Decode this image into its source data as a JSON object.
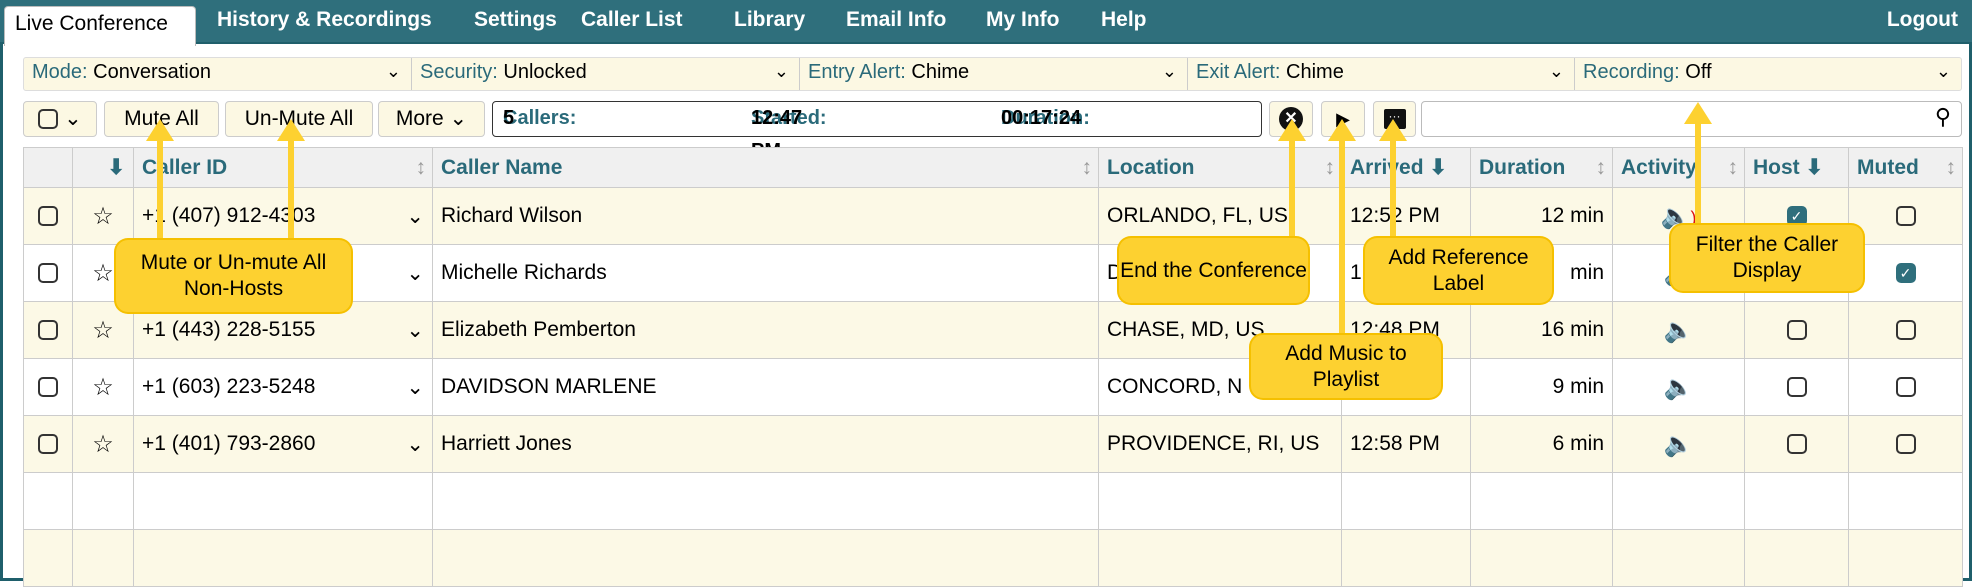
{
  "tabs": [
    "Live Conference",
    "History & Recordings",
    "Settings",
    "Caller List",
    "Library",
    "Email Info",
    "My Info",
    "Help"
  ],
  "logout": "Logout",
  "selectors": [
    {
      "key": "Mode:",
      "value": "Conversation"
    },
    {
      "key": "Security:",
      "value": "Unlocked"
    },
    {
      "key": "Entry Alert:",
      "value": "Chime"
    },
    {
      "key": "Exit Alert:",
      "value": "Chime"
    },
    {
      "key": "Recording:",
      "value": "Off"
    }
  ],
  "toolbar": {
    "mute_all": "Mute All",
    "unmute_all": "Un-Mute All",
    "more": "More",
    "callers_label": "Callers:",
    "callers": "5",
    "started_label": "Started:",
    "started": "12:47 PM",
    "duration_label": "Duration:",
    "duration": "00:17:24",
    "search_placeholder": ""
  },
  "columns": [
    "Caller ID",
    "Caller Name",
    "Location",
    "Arrived",
    "Duration",
    "Activity",
    "Host",
    "Muted"
  ],
  "rows": [
    {
      "caller_id": "+1 (407) 912-4303",
      "name": "Richard Wilson",
      "location": "ORLANDO, FL, US",
      "arrived": "12:52 PM",
      "duration": "12 min",
      "activity": "speaking",
      "host": true,
      "muted": false
    },
    {
      "caller_id": "",
      "name": "Michelle Richards",
      "location": "D",
      "arrived": "1",
      "duration": "min",
      "activity": "quiet",
      "host": false,
      "muted": true
    },
    {
      "caller_id": "+1 (443) 228-5155",
      "name": "Elizabeth Pemberton",
      "location": "CHASE, MD, US",
      "arrived": "12:48 PM",
      "duration": "16 min",
      "activity": "quiet",
      "host": false,
      "muted": false
    },
    {
      "caller_id": "+1 (603) 223-5248",
      "name": "DAVIDSON MARLENE",
      "location": "CONCORD, N",
      "arrived": "M",
      "duration": "9 min",
      "activity": "quiet",
      "host": false,
      "muted": false
    },
    {
      "caller_id": "+1 (401) 793-2860",
      "name": "Harriett Jones",
      "location": "PROVIDENCE, RI, US",
      "arrived": "12:58 PM",
      "duration": "6 min",
      "activity": "quiet",
      "host": false,
      "muted": false
    }
  ],
  "callouts": {
    "mute": "Mute or Un-mute All Non-Hosts",
    "end": "End the Conference",
    "music": "Add Music to Playlist",
    "label": "Add Reference Label",
    "filter": "Filter the Caller Display"
  },
  "colors": {
    "brand": "#2f6f7c",
    "callout": "#fdd130",
    "row_alt": "#fcf9e6"
  }
}
